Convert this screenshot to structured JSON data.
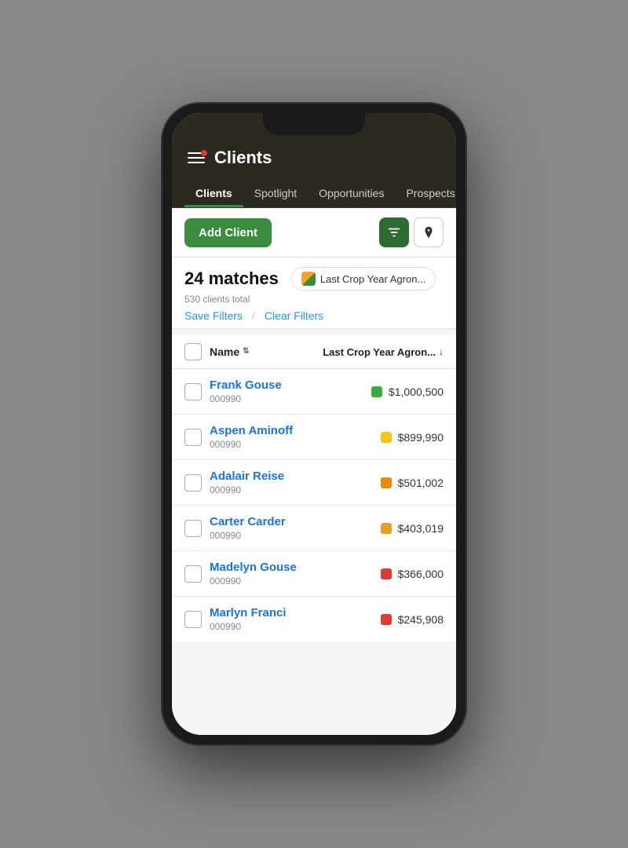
{
  "app": {
    "title": "Clients"
  },
  "header": {
    "title": "Clients",
    "notification": true
  },
  "nav": {
    "tabs": [
      {
        "label": "Clients",
        "active": true
      },
      {
        "label": "Spotlight",
        "active": false
      },
      {
        "label": "Opportunities",
        "active": false
      },
      {
        "label": "Prospects",
        "active": false
      }
    ]
  },
  "toolbar": {
    "add_button_label": "Add Client",
    "filter_icon_label": "filter-icon",
    "location_icon_label": "location-icon"
  },
  "matches": {
    "count": "24 matches",
    "total": "530 clients total",
    "filter_badge_label": "Last Crop Year Agron...",
    "save_filters_label": "Save Filters",
    "clear_filters_label": "Clear Filters"
  },
  "table": {
    "header": {
      "name_col": "Name",
      "value_col": "Last Crop Year Agron..."
    },
    "rows": [
      {
        "name": "Frank Gouse",
        "id": "000990",
        "color": "#3aaa3f",
        "amount": "$1,000,500"
      },
      {
        "name": "Aspen Aminoff",
        "id": "000990",
        "color": "#f5c518",
        "amount": "$899,990"
      },
      {
        "name": "Adalair Reise",
        "id": "000990",
        "color": "#e8890a",
        "amount": "$501,002"
      },
      {
        "name": "Carter Carder",
        "id": "000990",
        "color": "#e8a020",
        "amount": "$403,019"
      },
      {
        "name": "Madelyn Gouse",
        "id": "000990",
        "color": "#e03a2f",
        "amount": "$366,000"
      },
      {
        "name": "Marlyn Franci",
        "id": "000990",
        "color": "#e03a2f",
        "amount": "$245,908"
      }
    ]
  }
}
